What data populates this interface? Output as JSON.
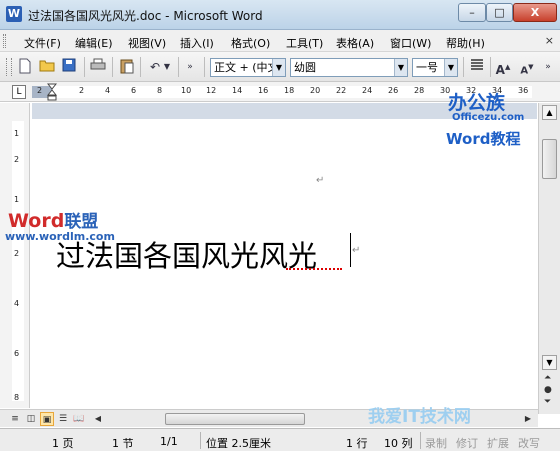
{
  "window": {
    "title": "过法国各国风光风光.doc - Microsoft Word",
    "app_icon_letter": "W",
    "minimize": "–",
    "maximize": "□",
    "close": "X"
  },
  "menubar": {
    "items": [
      "文件(F)",
      "编辑(E)",
      "视图(V)",
      "插入(I)",
      "格式(O)",
      "工具(T)",
      "表格(A)",
      "窗口(W)",
      "帮助(H)"
    ],
    "close_doc": "×"
  },
  "toolbar": {
    "style_value": "正文 + (中文",
    "font_value": "幼圆",
    "size_value": "一号",
    "grow_font": "A",
    "shrink_font": "A"
  },
  "ruler": {
    "corner": "L",
    "ticks": [
      "2",
      "2",
      "4",
      "6",
      "8",
      "10",
      "12",
      "14",
      "16",
      "18",
      "20",
      "22",
      "24",
      "26",
      "28",
      "30",
      "32",
      "34",
      "36"
    ]
  },
  "vruler": {
    "ticks": [
      "1",
      "2",
      "1",
      "2",
      "4",
      "6",
      "8"
    ]
  },
  "document": {
    "text": "过法国各国风光风光",
    "para_mark": "↵"
  },
  "watermarks": {
    "word": "Word",
    "lianmeng": "联盟",
    "url": "www.wordlm.com",
    "office_brand": "办公族",
    "office_url": "Officezu.com",
    "office_sub": "Word教程",
    "tech": "我爱IT技术网"
  },
  "statusbar": {
    "page": "1 页",
    "section": "1 节",
    "page_of": "1/1",
    "position": "位置 2.5厘米",
    "line": "1 行",
    "column": "10 列",
    "record": "录制",
    "revision": "修订",
    "extend": "扩展",
    "overtype": "改写"
  },
  "colors": {
    "accent": "#2b5fb4",
    "watermark_red": "#d12b2b",
    "watermark_blue": "#1e5fc6"
  }
}
